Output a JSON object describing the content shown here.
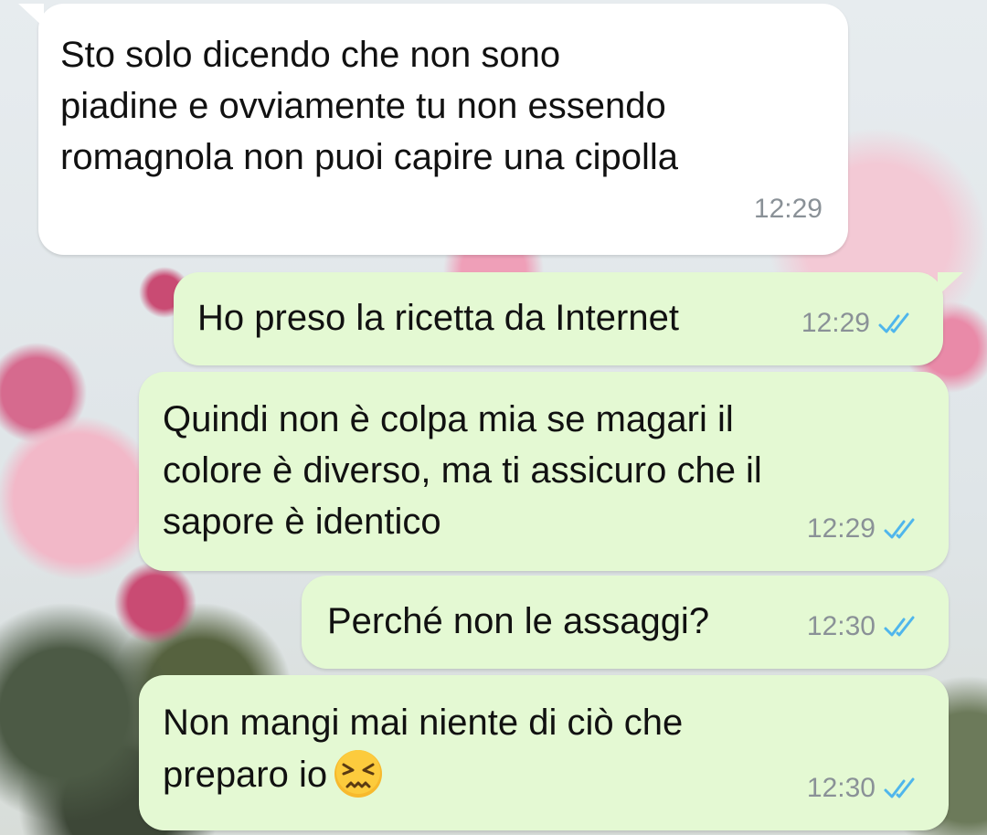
{
  "chat": {
    "messages": [
      {
        "direction": "incoming",
        "text": "Sto solo dicendo che non sono\npiadine e ovviamente tu non essendo\nromagnola non puoi capire una cipolla",
        "time": "12:29"
      },
      {
        "direction": "outgoing",
        "text": "Ho preso la ricetta da Internet",
        "time": "12:29",
        "read_status": "read-double-check"
      },
      {
        "direction": "outgoing",
        "text": "Quindi non è colpa mia se magari il\ncolore è diverso, ma ti assicuro che il\nsapore è identico",
        "time": "12:29",
        "read_status": "read-double-check"
      },
      {
        "direction": "outgoing",
        "text": "Perché non le assaggi?",
        "time": "12:30",
        "read_status": "read-double-check"
      },
      {
        "direction": "outgoing",
        "text": "Non mangi mai niente di ciò che\npreparo io",
        "emoji": "persevering-face",
        "time": "12:30",
        "read_status": "read-double-check"
      }
    ]
  },
  "colors": {
    "incoming_bubble": "#ffffff",
    "outgoing_bubble": "#e4f9d3",
    "read_ticks": "#4fb6ec",
    "timestamp": "#8a9197"
  }
}
